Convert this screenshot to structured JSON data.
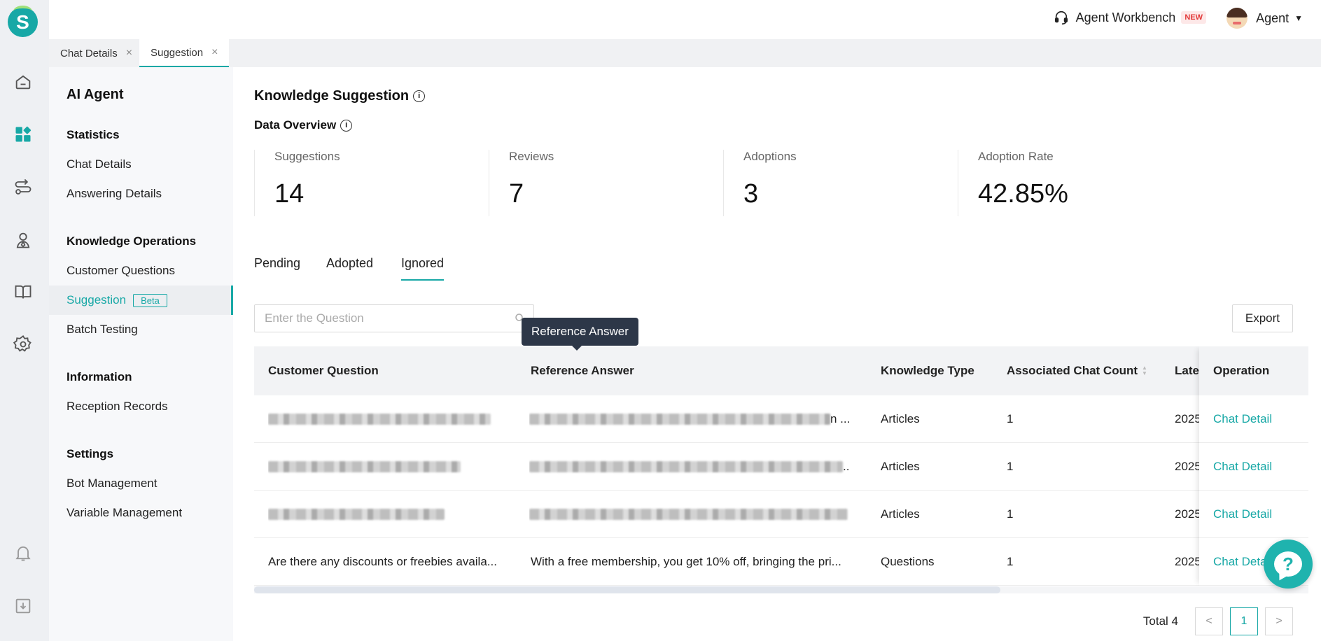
{
  "colors": {
    "accent": "#17a8a6",
    "tooltip_bg": "#2d3748",
    "new_badge": "#e23b3b"
  },
  "header": {
    "workbench_label": "Agent Workbench",
    "new_badge": "NEW",
    "user_label": "Agent"
  },
  "rail_icons": [
    "home-icon",
    "dashboard-icon",
    "routing-icon",
    "agent-icon",
    "knowledge-book-icon",
    "settings-gear-icon",
    "bell-icon",
    "download-icon"
  ],
  "page_tabs": [
    {
      "label": "Chat Details",
      "close": "×"
    },
    {
      "label": "Suggestion",
      "close": "×"
    }
  ],
  "sidebar": {
    "title": "AI Agent",
    "sections": [
      {
        "heading": "Statistics",
        "items": [
          "Chat Details",
          "Answering Details"
        ]
      },
      {
        "heading": "Knowledge Operations",
        "items": [
          "Customer Questions",
          "Suggestion",
          "Batch Testing"
        ]
      },
      {
        "heading": "Information",
        "items": [
          "Reception Records"
        ]
      },
      {
        "heading": "Settings",
        "items": [
          "Bot Management",
          "Variable Management"
        ]
      }
    ],
    "beta_badge": "Beta"
  },
  "main": {
    "title": "Knowledge Suggestion",
    "overview_title": "Data Overview",
    "info_icon": "i",
    "stats": [
      {
        "label": "Suggestions",
        "value": "14"
      },
      {
        "label": "Reviews",
        "value": "7"
      },
      {
        "label": "Adoptions",
        "value": "3"
      },
      {
        "label": "Adoption Rate",
        "value": "42.85%"
      }
    ],
    "tabs": [
      "Pending",
      "Adopted",
      "Ignored"
    ],
    "search_placeholder": "Enter the Question",
    "tooltip": "Reference Answer",
    "export_label": "Export"
  },
  "table": {
    "columns": [
      "Customer Question",
      "Reference Answer",
      "Knowledge Type",
      "Associated Chat Count",
      "Lates",
      "Operation"
    ],
    "rows": [
      {
        "question": "",
        "answer_tail": "n ...",
        "type": "Articles",
        "count": "1",
        "latest": "2025",
        "op": "Chat Detail"
      },
      {
        "question": "",
        "answer_tail": "..",
        "type": "Articles",
        "count": "1",
        "latest": "2025",
        "op": "Chat Detail"
      },
      {
        "question": "",
        "answer_tail": "",
        "type": "Articles",
        "count": "1",
        "latest": "2025",
        "op": "Chat Detail"
      },
      {
        "question": "Are there any discounts or freebies availa...",
        "answer_tail": "With a free membership, you get 10% off, bringing the pri...",
        "type": "Questions",
        "count": "1",
        "latest": "2025",
        "op": "Chat Deta"
      }
    ]
  },
  "pagination": {
    "total_label": "Total 4",
    "prev": "<",
    "current": "1",
    "next": ">"
  },
  "help_fab": "?"
}
